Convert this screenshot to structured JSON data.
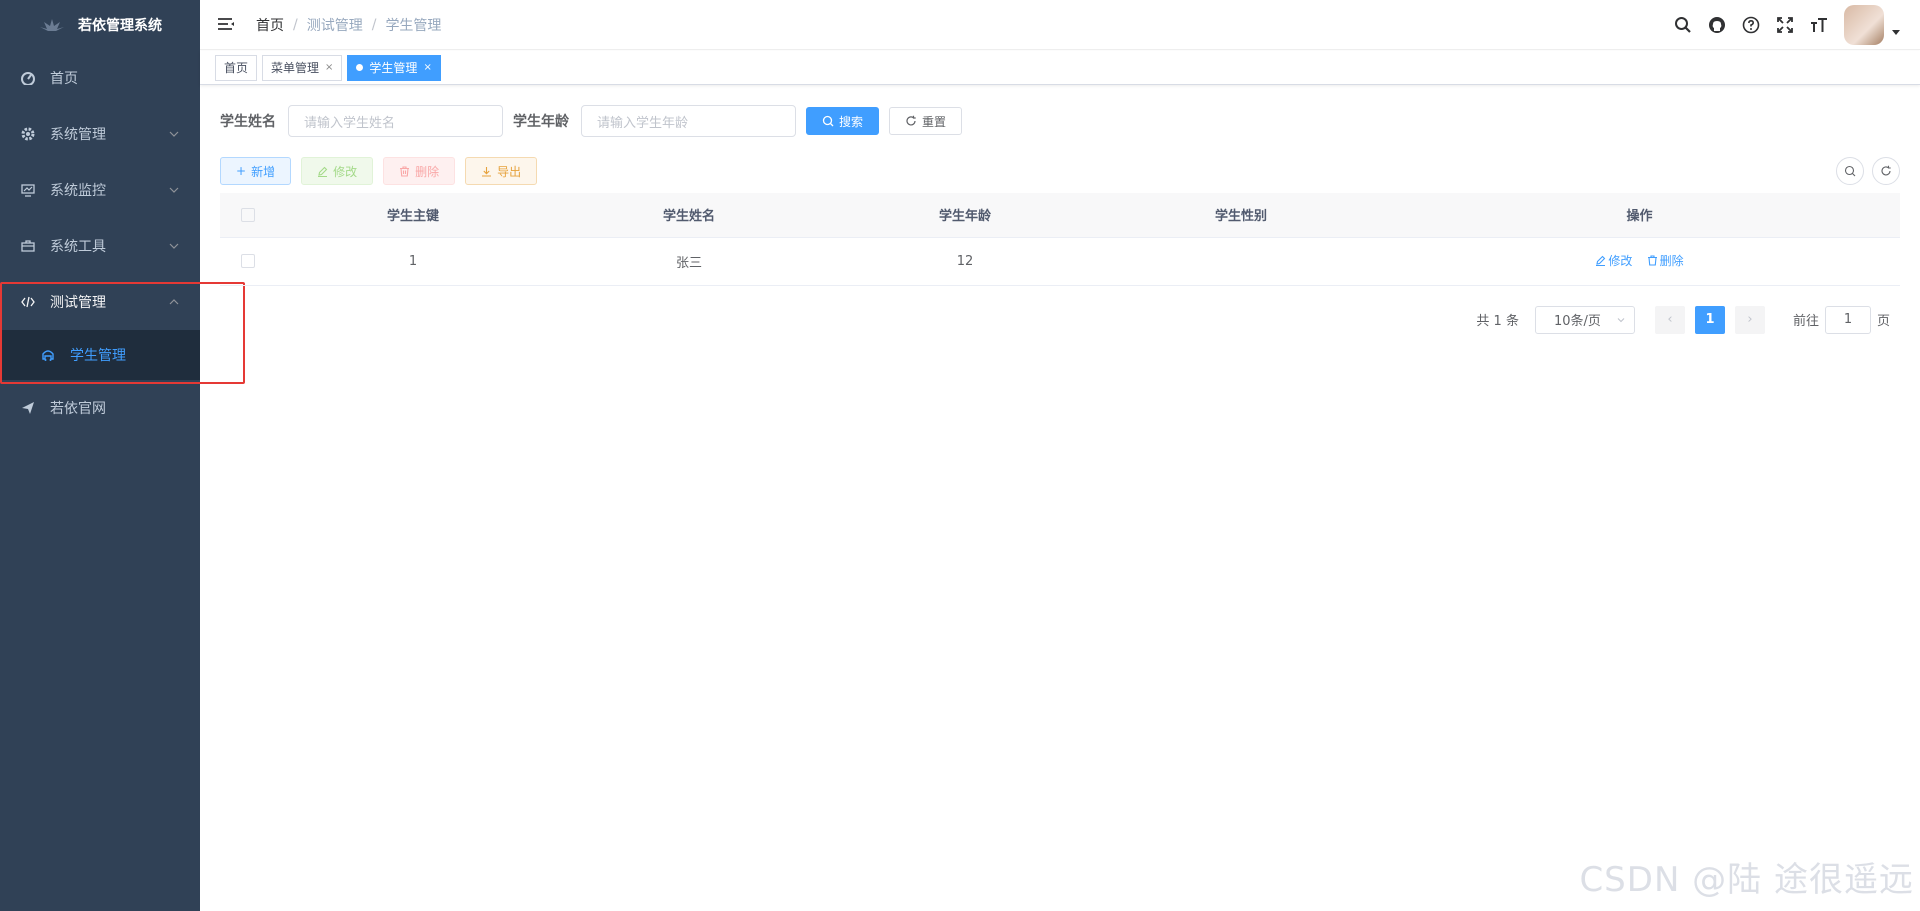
{
  "app": {
    "title": "若依管理系统"
  },
  "sidebar": {
    "items": [
      {
        "label": "首页",
        "icon": "dashboard-icon"
      },
      {
        "label": "系统管理",
        "icon": "gear-icon"
      },
      {
        "label": "系统监控",
        "icon": "monitor-icon"
      },
      {
        "label": "系统工具",
        "icon": "toolbox-icon"
      },
      {
        "label": "测试管理",
        "icon": "code-icon",
        "open": true
      },
      {
        "label": "若依官网",
        "icon": "send-icon"
      }
    ],
    "submenu": [
      {
        "label": "学生管理",
        "icon": "student-icon",
        "active": true
      }
    ]
  },
  "breadcrumb": [
    "首页",
    "测试管理",
    "学生管理"
  ],
  "tags": [
    {
      "label": "首页",
      "closable": false
    },
    {
      "label": "菜单管理",
      "closable": true
    },
    {
      "label": "学生管理",
      "closable": true,
      "active": true
    }
  ],
  "search": {
    "name_label": "学生姓名",
    "name_placeholder": "请输入学生姓名",
    "age_label": "学生年龄",
    "age_placeholder": "请输入学生年龄",
    "search_button": "搜索",
    "reset_button": "重置"
  },
  "toolbar": {
    "add": "新增",
    "edit": "修改",
    "delete": "删除",
    "export": "导出"
  },
  "table": {
    "columns": [
      "学生主键",
      "学生姓名",
      "学生年龄",
      "学生性别",
      "操作"
    ],
    "rows": [
      {
        "id": "1",
        "name": "张三",
        "age": "12",
        "gender": "",
        "edit": "修改",
        "delete": "删除"
      }
    ]
  },
  "pagination": {
    "total_text": "共 1 条",
    "page_size": "10条/页",
    "current_page": "1",
    "goto_label": "前往",
    "goto_value": "1",
    "page_suffix": "页"
  },
  "watermark": "CSDN @陆 途很遥远",
  "colors": {
    "sidebar": "#304156",
    "primary": "#409eff",
    "highlight": "#e53935"
  }
}
